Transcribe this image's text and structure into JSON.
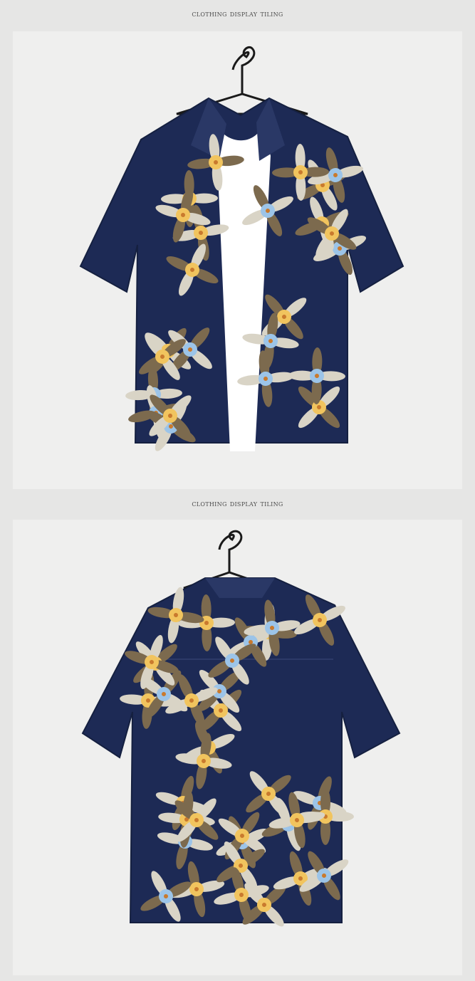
{
  "sections": [
    {
      "caption": "CLOTHING DISPLAY TILING",
      "view": "front"
    },
    {
      "caption": "CLOTHING DISPLAY TILING",
      "view": "back"
    }
  ],
  "colors": {
    "background": "#e6e6e5",
    "panel": "#efefee",
    "shirt_navy": "#1d2a55",
    "leaf_light": "#d9d4c6",
    "leaf_dark": "#7c6a4e",
    "flower_yellow": "#f1c45e",
    "flower_blue": "#9cc4e8",
    "undershirt": "#ffffff"
  },
  "icons": [
    "hanger-icon"
  ]
}
